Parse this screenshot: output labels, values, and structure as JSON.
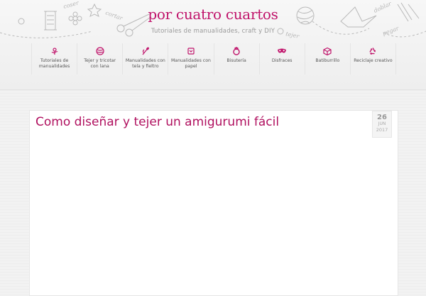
{
  "site": {
    "title": "por cuatro cuartos",
    "tagline": "Tutoriales de manualidades, craft y DIY",
    "brand_color": "#c0146b",
    "doodle_words": [
      "coser",
      "cortar",
      "tejer",
      "doblar",
      "pegar"
    ]
  },
  "nav": {
    "items": [
      {
        "label": "Tutoriales de manualidades",
        "icon": "flower-icon"
      },
      {
        "label": "Tejer y tricotar con lana",
        "icon": "yarn-ball-icon"
      },
      {
        "label": "Manualidades con tela y fieltro",
        "icon": "needle-icon"
      },
      {
        "label": "Manualidades con papel",
        "icon": "paper-icon"
      },
      {
        "label": "Bisutería",
        "icon": "ring-icon"
      },
      {
        "label": "Disfraces",
        "icon": "mask-icon"
      },
      {
        "label": "Batiburrillo",
        "icon": "box-icon"
      },
      {
        "label": "Reciclaje creativo",
        "icon": "recycle-icon"
      }
    ]
  },
  "post": {
    "title": "Como diseñar y tejer un amigurumi fácil",
    "date": {
      "day": "26",
      "month": "JUN",
      "year": "2017"
    }
  }
}
